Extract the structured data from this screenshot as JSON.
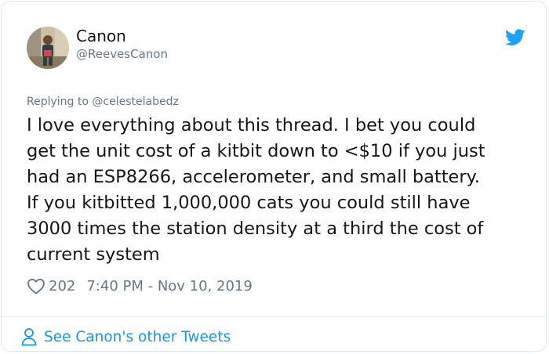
{
  "user": {
    "name": "Canon",
    "handle": "@ReevesCanon"
  },
  "reply": {
    "prefix": "Replying to",
    "mention": "@celestelabedz"
  },
  "tweet": {
    "lines": [
      "I love everything about this thread. I bet you could",
      "get the unit cost of a kitbit down to <$10 if you just",
      "had an ESP8266, accelerometer, and small battery.",
      "If you kitbitted 1,000,000 cats you could still have",
      "3000 times the station density at a third the cost of",
      "current system"
    ]
  },
  "meta": {
    "likes": "202",
    "timestamp": "7:40 PM - Nov 10, 2019"
  },
  "footer": {
    "link_label": "See Canon's other Tweets"
  },
  "icons": {
    "brand": "twitter-bird-icon",
    "like": "heart-icon",
    "profile": "person-icon"
  },
  "colors": {
    "brand_blue": "#1da1f2",
    "link_blue": "#1b95e0",
    "secondary_text": "#657786",
    "primary_text": "#14171a"
  }
}
